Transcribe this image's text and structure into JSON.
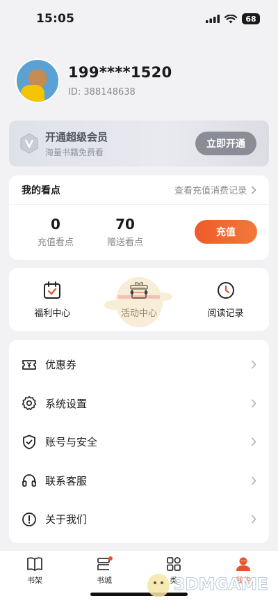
{
  "status": {
    "time": "15:05",
    "battery": "68"
  },
  "profile": {
    "phone": "199****1520",
    "id_text": "ID: 388148638"
  },
  "vip": {
    "title": "开通超级会员",
    "subtitle": "海量书籍免费看",
    "button": "立即开通"
  },
  "points": {
    "title": "我的看点",
    "link": "查看充值消费记录",
    "stats": [
      {
        "value": "0",
        "label": "充值看点"
      },
      {
        "value": "70",
        "label": "赠送看点"
      }
    ],
    "recharge_button": "充值"
  },
  "quick_actions": [
    {
      "label": "福利中心",
      "icon": "calendar-check-icon"
    },
    {
      "label": "活动中心",
      "icon": "gift-box-icon"
    },
    {
      "label": "阅读记录",
      "icon": "clock-icon"
    }
  ],
  "menu": [
    {
      "label": "优惠券",
      "icon": "coupon-icon"
    },
    {
      "label": "系统设置",
      "icon": "gear-icon"
    },
    {
      "label": "账号与安全",
      "icon": "shield-icon"
    },
    {
      "label": "联系客服",
      "icon": "headset-icon"
    },
    {
      "label": "关于我们",
      "icon": "info-icon"
    }
  ],
  "tabs": [
    {
      "label": "书架",
      "icon": "book-icon"
    },
    {
      "label": "书城",
      "icon": "store-icon"
    },
    {
      "label": "类",
      "icon": "grid-icon"
    },
    {
      "label": "我的",
      "icon": "user-icon"
    }
  ],
  "colors": {
    "accent": "#E8542A",
    "vip_button": "#8A8D96",
    "background": "#F2F2F4"
  },
  "watermark": "3DMGAME"
}
